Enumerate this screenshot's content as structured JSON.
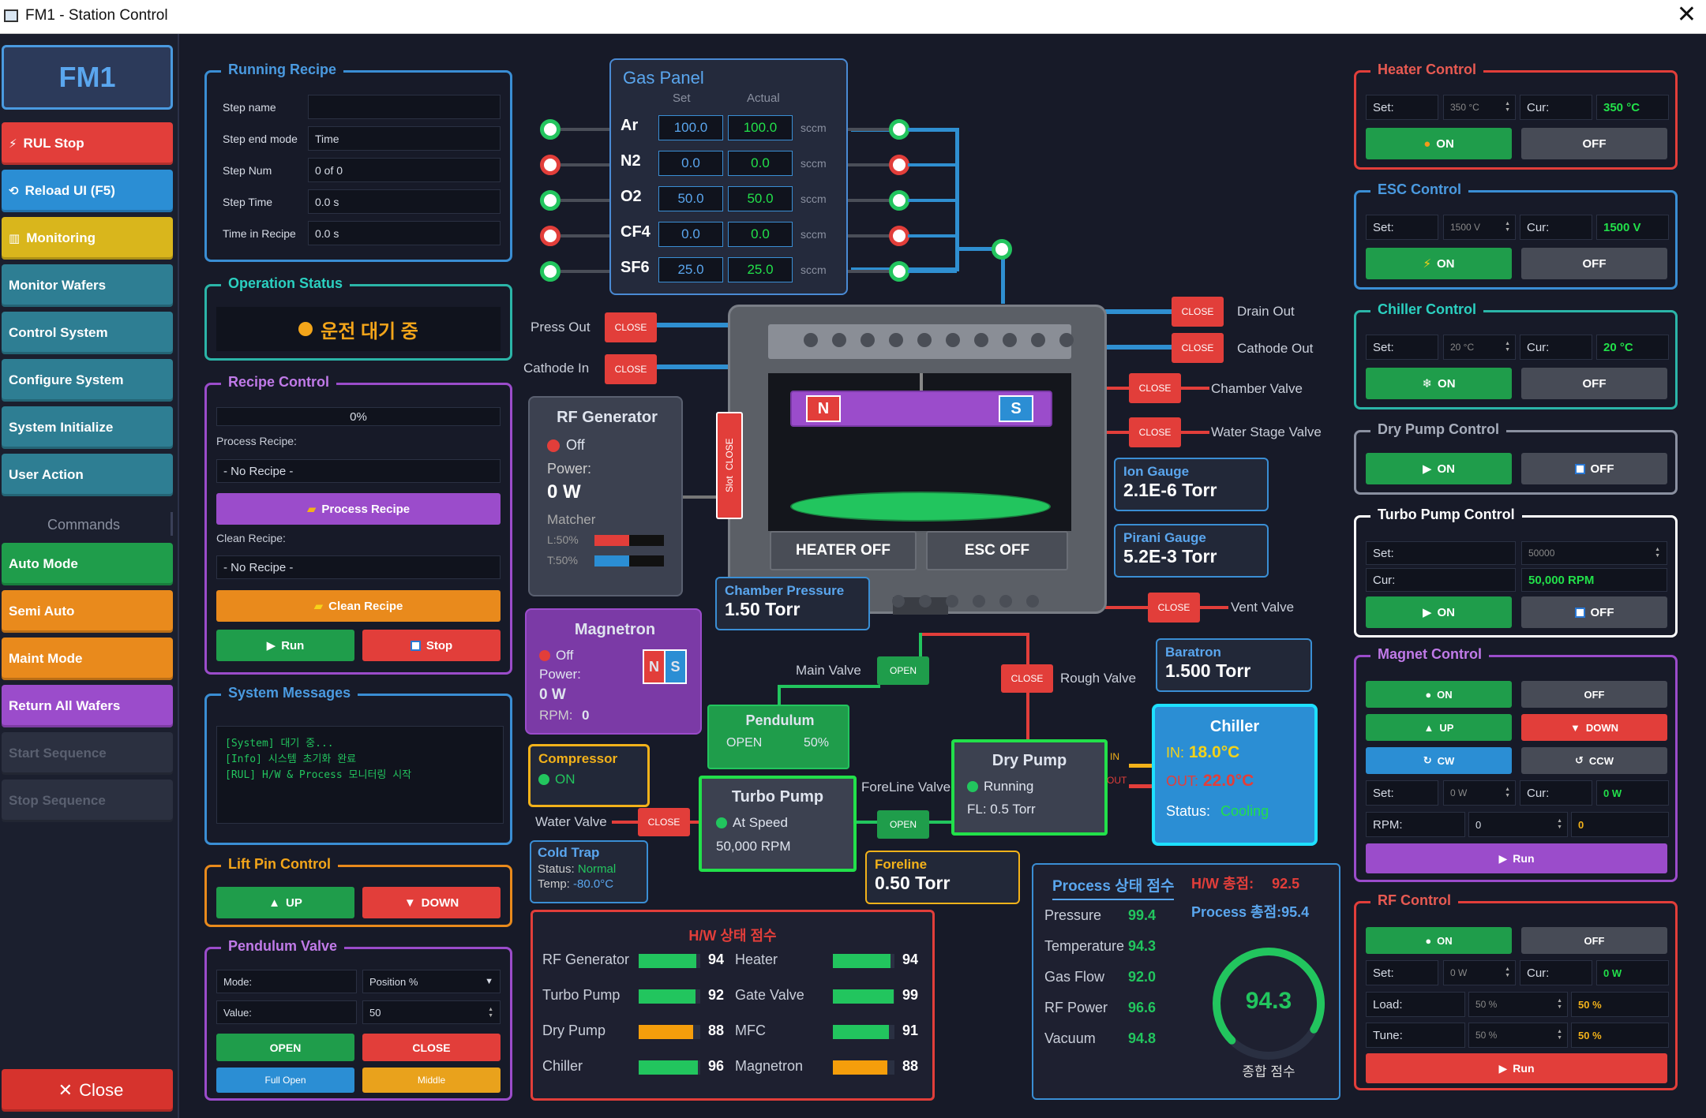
{
  "window": {
    "title": "FM1 - Station Control"
  },
  "sidebar": {
    "brand": "FM1",
    "buttons": [
      {
        "label": "RUL Stop",
        "color": "#e23e3a",
        "icon": "⚡"
      },
      {
        "label": "Reload UI (F5)",
        "color": "#2b8ed4",
        "icon": "⟲"
      },
      {
        "label": "Monitoring",
        "color": "#d9b61c",
        "icon": "▥"
      },
      {
        "label": "Monitor Wafers",
        "color": "#2e7e93",
        "icon": ""
      },
      {
        "label": "Control System",
        "color": "#2e7e93",
        "icon": ""
      },
      {
        "label": "Configure System",
        "color": "#2e7e93",
        "icon": ""
      },
      {
        "label": "System Initialize",
        "color": "#2e7e93",
        "icon": ""
      },
      {
        "label": "User Action",
        "color": "#2e7e93",
        "icon": ""
      }
    ],
    "commands_label": "Commands",
    "commands": [
      {
        "label": "Auto Mode",
        "color": "#1f9d4b"
      },
      {
        "label": "Semi Auto",
        "color": "#e98a1c"
      },
      {
        "label": "Maint Mode",
        "color": "#e98a1c"
      },
      {
        "label": "Return All Wafers",
        "color": "#9b4ccb"
      },
      {
        "label": "Start Sequence",
        "color": "#2b3040"
      },
      {
        "label": "Stop Sequence",
        "color": "#2b3040"
      }
    ],
    "close_label": "Close"
  },
  "running_recipe": {
    "title": "Running Recipe",
    "rows": [
      {
        "label": "Step name",
        "value": ""
      },
      {
        "label": "Step end mode",
        "value": "Time"
      },
      {
        "label": "Step Num",
        "value": "0 of 0"
      },
      {
        "label": "Step Time",
        "value": "0.0 s"
      },
      {
        "label": "Time in Recipe",
        "value": "0.0 s"
      }
    ]
  },
  "operation_status": {
    "title": "Operation Status",
    "text": "운전 대기 중"
  },
  "recipe_control": {
    "title": "Recipe Control",
    "progress": "0%",
    "process_label": "Process Recipe:",
    "process_value": "- No Recipe -",
    "process_btn": "Process Recipe",
    "clean_label": "Clean Recipe:",
    "clean_value": "- No Recipe -",
    "clean_btn": "Clean Recipe",
    "run": "Run",
    "stop": "Stop"
  },
  "system_messages": {
    "title": "System Messages",
    "lines": [
      "[System] 대기 중...",
      "[Info] 시스템 초기화 완료",
      "[RUL] H/W & Process 모니터링 시작"
    ]
  },
  "lift_pin": {
    "title": "Lift Pin Control",
    "up": "UP",
    "down": "DOWN"
  },
  "pendulum_valve": {
    "title": "Pendulum Valve",
    "mode_label": "Mode:",
    "mode_value": "Position %",
    "value_label": "Value:",
    "value": "50",
    "open": "OPEN",
    "close": "CLOSE",
    "full_open": "Full Open",
    "middle": "Middle"
  },
  "gas_panel": {
    "title": "Gas Panel",
    "set_hdr": "Set",
    "actual_hdr": "Actual",
    "unit": "sccm",
    "gases": [
      {
        "name": "Ar",
        "set": "100.0",
        "actual": "100.0",
        "on": true
      },
      {
        "name": "N2",
        "set": "0.0",
        "actual": "0.0",
        "on": false
      },
      {
        "name": "O2",
        "set": "50.0",
        "actual": "50.0",
        "on": true
      },
      {
        "name": "CF4",
        "set": "0.0",
        "actual": "0.0",
        "on": false
      },
      {
        "name": "SF6",
        "set": "25.0",
        "actual": "25.0",
        "on": true
      }
    ]
  },
  "chamber": {
    "press_out": "Press Out",
    "cathode_in": "Cathode In",
    "close": "CLOSE",
    "open": "OPEN",
    "drain_out": "Drain Out",
    "cathode_out": "Cathode Out",
    "chamber_valve": "Chamber Valve",
    "water_stage_valve": "Water Stage Valve",
    "vent_valve": "Vent Valve",
    "slot": "Slot",
    "heater_off": "HEATER OFF",
    "esc_off": "ESC OFF",
    "magnet_n": "N",
    "magnet_s": "S",
    "main_valve": "Main Valve",
    "rough_valve": "Rough Valve",
    "foreline_valve": "ForeLine Valve",
    "water_valve": "Water Valve"
  },
  "rf_generator": {
    "title": "RF Generator",
    "state": "Off",
    "power_label": "Power:",
    "power": "0 W",
    "matcher": "Matcher",
    "load": "L:50%",
    "tune": "T:50%",
    "load_pct": 50,
    "tune_pct": 50
  },
  "magnetron": {
    "title": "Magnetron",
    "state": "Off",
    "power_label": "Power:",
    "power": "0 W",
    "rpm_label": "RPM:",
    "rpm": "0"
  },
  "gauges": {
    "ion": {
      "title": "Ion Gauge",
      "value": "2.1E-6 Torr"
    },
    "pirani": {
      "title": "Pirani Gauge",
      "value": "5.2E-3 Torr"
    },
    "chamber_pressure": {
      "title": "Chamber Pressure",
      "value": "1.50 Torr"
    },
    "baratron": {
      "title": "Baratron",
      "value": "1.500 Torr"
    },
    "foreline": {
      "title": "Foreline",
      "value": "0.50 Torr"
    }
  },
  "pendulum": {
    "title": "Pendulum",
    "state": "OPEN",
    "pct": "50%"
  },
  "compressor": {
    "title": "Compressor",
    "state": "ON"
  },
  "turbo_pump": {
    "title": "Turbo Pump",
    "state": "At Speed",
    "rpm": "50,000 RPM"
  },
  "dry_pump": {
    "title": "Dry Pump",
    "state": "Running",
    "fl": "FL: 0.5 Torr"
  },
  "cold_trap": {
    "title": "Cold Trap",
    "status_label": "Status:",
    "status": "Normal",
    "temp_label": "Temp:",
    "temp": "-80.0°C"
  },
  "chiller": {
    "title": "Chiller",
    "in_label": "IN:",
    "in": "18.0°C",
    "out_label": "OUT:",
    "out": "22.0°C",
    "status_label": "Status:",
    "status": "Cooling",
    "in_tag": "IN",
    "out_tag": "OUT"
  },
  "hw_score": {
    "title": "H/W 상태 점수",
    "items": [
      {
        "name": "RF Generator",
        "score": 94,
        "color": "#22c55e"
      },
      {
        "name": "Turbo Pump",
        "score": 92,
        "color": "#22c55e"
      },
      {
        "name": "Dry Pump",
        "score": 88,
        "color": "#f59e0b"
      },
      {
        "name": "Chiller",
        "score": 96,
        "color": "#22c55e"
      },
      {
        "name": "Heater",
        "score": 94,
        "color": "#22c55e"
      },
      {
        "name": "Gate Valve",
        "score": 99,
        "color": "#22c55e"
      },
      {
        "name": "MFC",
        "score": 91,
        "color": "#22c55e"
      },
      {
        "name": "Magnetron",
        "score": 88,
        "color": "#f59e0b"
      }
    ]
  },
  "process_score": {
    "title": "Process 상태 점수",
    "hw_total_label": "H/W 총점:",
    "hw_total": "92.5",
    "process_total": "Process 총점:95.4",
    "items": [
      {
        "name": "Pressure",
        "score": "99.4"
      },
      {
        "name": "Temperature",
        "score": "94.3"
      },
      {
        "name": "Gas Flow",
        "score": "92.0"
      },
      {
        "name": "RF Power",
        "score": "96.6"
      },
      {
        "name": "Vacuum",
        "score": "94.8"
      }
    ],
    "gauge_value": "94.3",
    "gauge_pct": 94.3,
    "gauge_label": "종합 점수"
  },
  "heater": {
    "title": "Heater Control",
    "set_label": "Set:",
    "set": "350 °C",
    "cur_label": "Cur:",
    "cur": "350 °C",
    "on": "ON",
    "off": "OFF"
  },
  "esc": {
    "title": "ESC Control",
    "set_label": "Set:",
    "set": "1500 V",
    "cur_label": "Cur:",
    "cur": "1500 V",
    "on": "ON",
    "off": "OFF"
  },
  "chiller_ctrl": {
    "title": "Chiller Control",
    "set_label": "Set:",
    "set": "20 °C",
    "cur_label": "Cur:",
    "cur": "20 °C",
    "on": "ON",
    "off": "OFF"
  },
  "dry_pump_ctrl": {
    "title": "Dry Pump Control",
    "on": "ON",
    "off": "OFF"
  },
  "turbo_ctrl": {
    "title": "Turbo Pump Control",
    "set_label": "Set:",
    "set": "50000",
    "cur_label": "Cur:",
    "cur": "50,000 RPM",
    "on": "ON",
    "off": "OFF"
  },
  "magnet_ctrl": {
    "title": "Magnet Control",
    "on": "ON",
    "off": "OFF",
    "up": "UP",
    "down": "DOWN",
    "cw": "CW",
    "ccw": "CCW",
    "set_label": "Set:",
    "set": "0 W",
    "cur_label": "Cur:",
    "cur": "0 W",
    "rpm_label": "RPM:",
    "rpm": "0",
    "rpm_cur": "0",
    "run": "Run"
  },
  "rf_ctrl": {
    "title": "RF Control",
    "on": "ON",
    "off": "OFF",
    "set_label": "Set:",
    "set": "0 W",
    "cur_label": "Cur:",
    "cur": "0 W",
    "load_label": "Load:",
    "load": "50 %",
    "load_cur": "50 %",
    "tune_label": "Tune:",
    "tune": "50 %",
    "tune_cur": "50 %",
    "run": "Run"
  }
}
